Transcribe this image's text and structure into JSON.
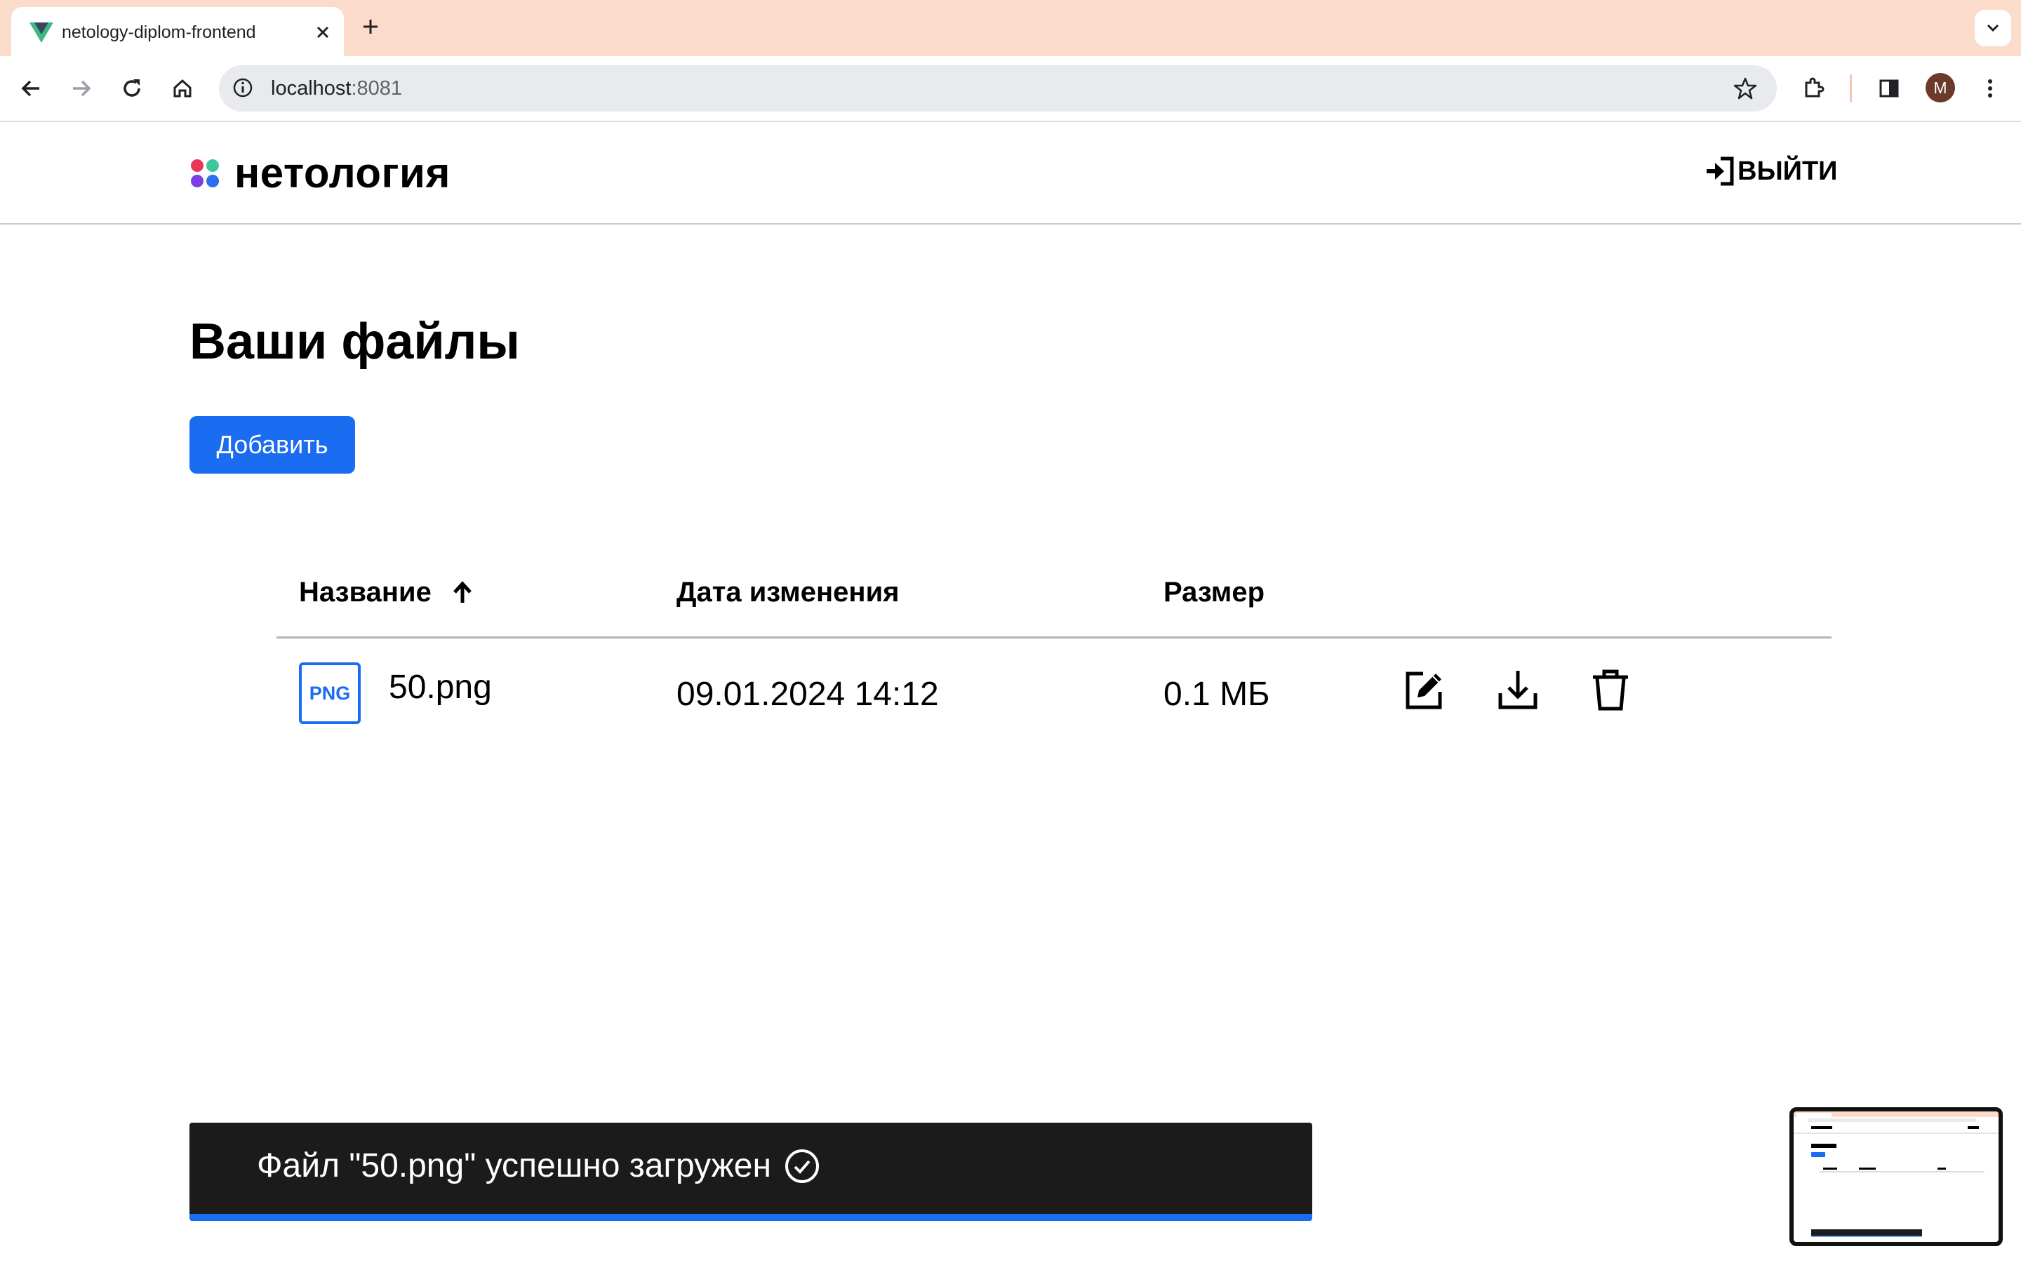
{
  "browser": {
    "tab_title": "netology-diplom-frontend",
    "url_host": "localhost",
    "url_port": ":8081",
    "profile_initial": "M"
  },
  "header": {
    "logo_text": "нетология",
    "logout_label": "ВЫЙТИ"
  },
  "main": {
    "title": "Ваши файлы",
    "add_button_label": "Добавить",
    "table": {
      "columns": {
        "name": "Название",
        "date": "Дата изменения",
        "size": "Размер"
      },
      "sort": "ascending",
      "rows": [
        {
          "type_badge": "PNG",
          "name": "50.png",
          "modified": "09.01.2024 14:12",
          "size": "0.1 МБ"
        }
      ]
    }
  },
  "toast": {
    "message": "Файл \"50.png\" успешно загружен",
    "progress": 1.0
  },
  "colors": {
    "accent": "#1a6cf0",
    "tab_strip": "#fbdccb",
    "toast_bg": "#1b1b1b"
  }
}
